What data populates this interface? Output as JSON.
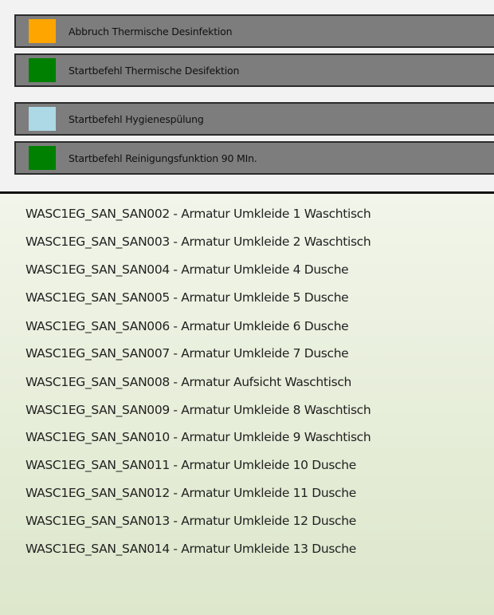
{
  "commands": [
    {
      "label": "Abbruch Thermische Desinfektion",
      "color": "#ffa500"
    },
    {
      "label": "Startbefehl Thermische Desifektion",
      "color": "#008000"
    },
    {
      "label": "Startbefehl Hygienespülung",
      "color": "#add8e6"
    },
    {
      "label": "Startbefehl Reinigungsfunktion 90 MIn.",
      "color": "#008000"
    }
  ],
  "items": [
    "WASC1EG_SAN_SAN002 - Armatur Umkleide 1 Waschtisch",
    "WASC1EG_SAN_SAN003 - Armatur Umkleide 2 Waschtisch",
    "WASC1EG_SAN_SAN004 - Armatur Umkleide 4 Dusche",
    "WASC1EG_SAN_SAN005 - Armatur Umkleide 5 Dusche",
    "WASC1EG_SAN_SAN006 - Armatur Umkleide 6 Dusche",
    "WASC1EG_SAN_SAN007 - Armatur Umkleide 7 Dusche",
    "WASC1EG_SAN_SAN008 - Armatur Aufsicht Waschtisch",
    "WASC1EG_SAN_SAN009 - Armatur Umkleide 8 Waschtisch",
    "WASC1EG_SAN_SAN010 - Armatur Umkleide 9 Waschtisch",
    "WASC1EG_SAN_SAN011 - Armatur Umkleide 10 Dusche",
    "WASC1EG_SAN_SAN012 - Armatur Umkleide 11 Dusche",
    "WASC1EG_SAN_SAN013 - Armatur Umkleide 12 Dusche",
    "WASC1EG_SAN_SAN014 - Armatur Umkleide 13 Dusche"
  ]
}
